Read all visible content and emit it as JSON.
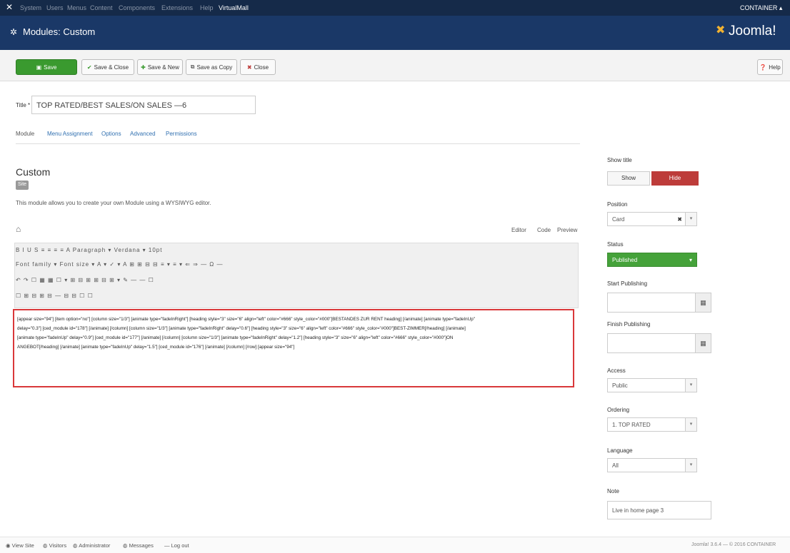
{
  "topnav": {
    "menu": [
      "System",
      "Users",
      "Menus",
      "Content",
      "Components",
      "Extensions",
      "Help"
    ],
    "site_link": "VirtualMall",
    "user": "CONTAINER"
  },
  "header": {
    "title": "Modules: Custom",
    "brand": "Joomla!"
  },
  "toolbar": {
    "save": "Save",
    "save_close": "Save & Close",
    "save_new": "Save & New",
    "save_copy": "Save as Copy",
    "close": "Close",
    "help": "Help"
  },
  "form": {
    "title_label": "Title *",
    "title_value": "TOP RATED/BEST SALES/ON SALES —6"
  },
  "tabs": [
    "Module",
    "Menu Assignment",
    "Options",
    "Advanced",
    "Permissions"
  ],
  "main": {
    "heading": "Custom",
    "badge": "Site",
    "description": "This module allows you to create your own Module using a WYSIWYG editor.",
    "editor_modes": [
      "Editor",
      "Code",
      "Preview"
    ],
    "toolbar_rows": [
      "B I U S ≡ ≡ ≡ ≡ A Paragraph ▾ Verdana ▾ 10pt",
      "Font family ▾ Font size ▾ A ▾ ✓ ▾ A ⊞ ⊞ ⊟ ⊟ ≡ ▾ ≡ ▾ ⇐ ⇒ — Ω —",
      "↶ ↷ ☐ ▦ ▦ ☐ ▾ ⊞ ⊟ ⊞ ⊞ ⊟ ⊞ ▾ ✎ — — ☐",
      "☐ ⊞ ⊟ ⊞ ⊟ — ⊟ ⊟ ☐ ☐"
    ],
    "content_lines": [
      "[appear size=\"94\"] [item option=\"no\"] [column size=\"1/3\"] [animate type=\"fadeInRight\"] [heading style=\"3\" size=\"6\" align=\"left\" color=\"#666\" style_color=\"#000\"]BESTANDES ZUR RENT heading] [/animate] [animate type=\"fadeInUp\"",
      "delay=\"0.3\"] [ced_module id=\"178\"] [/animate] [/column] [column size=\"1/3\"] [animate type=\"fadeInRight\" delay=\"0.6\"] [heading style=\"3\" size=\"6\" align=\"left\" color=\"#666\" style_color=\"#000\"]BEST-ZIMMER[/heading] [/animate]",
      "[animate type=\"fadeInUp\" delay=\"0.9\"] [ced_module id=\"177\"] [/animate] [/column] [column size=\"1/3\"] [animate type=\"fadeInRight\" delay=\"1.2\"] [heading style=\"3\" size=\"6\" align=\"left\" color=\"#666\" style_color=\"#000\"]ON",
      "ANGEBOT[/heading] [/animate] [animate type=\"fadeInUp\" delay=\"1.5\"] [ced_module id=\"176\"] [/animate] [/column] [/row] [appear size=\"94\"]"
    ]
  },
  "sidebar": {
    "show_title": {
      "label": "Show title",
      "show": "Show",
      "hide": "Hide"
    },
    "position": {
      "label": "Position",
      "value": "Card"
    },
    "status": {
      "label": "Status",
      "value": "Published"
    },
    "start_publishing": {
      "label": "Start Publishing"
    },
    "finish_publishing": {
      "label": "Finish Publishing"
    },
    "access": {
      "label": "Access",
      "value": "Public"
    },
    "ordering": {
      "label": "Ordering",
      "value": "1. TOP RATED"
    },
    "language": {
      "label": "Language",
      "value": "All"
    },
    "note": {
      "label": "Note",
      "value": "Live in home page 3"
    }
  },
  "footer": {
    "items": [
      "View Site",
      "Visitors",
      "Administrator",
      "Messages",
      "Log out"
    ],
    "version": "Joomla! 3.6.4 — © 2016 CONTAINER"
  },
  "colors": {
    "navy": "#152a49",
    "header": "#1a3867",
    "save_green": "#3a9a2f",
    "hide_red": "#bd3c3a",
    "published_green": "#45a23a",
    "highlight_border": "#d9383a"
  }
}
